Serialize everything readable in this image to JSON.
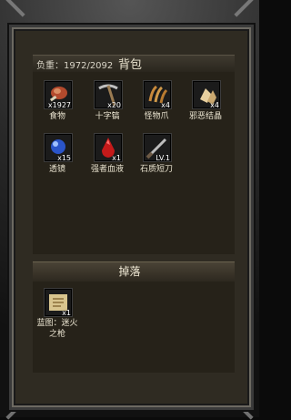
{
  "bag": {
    "weight_label": "负重：1972/2092",
    "title": "背包",
    "items": [
      {
        "label": "食物",
        "count": "x1927"
      },
      {
        "label": "十字镐",
        "count": "x20"
      },
      {
        "label": "怪物爪",
        "count": "x4"
      },
      {
        "label": "邪恶结晶",
        "count": "x4"
      },
      {
        "label": "透镜",
        "count": "x15"
      },
      {
        "label": "强者血液",
        "count": "x1"
      },
      {
        "label": "石质短刀",
        "count": "LV.1"
      }
    ]
  },
  "drop": {
    "title": "掉落",
    "items": [
      {
        "label_line1": "蓝图：迷火",
        "label_line2": "之枪",
        "count": "x1"
      }
    ]
  },
  "colors": {
    "panel": "#262219",
    "text": "#e9e3cf"
  }
}
